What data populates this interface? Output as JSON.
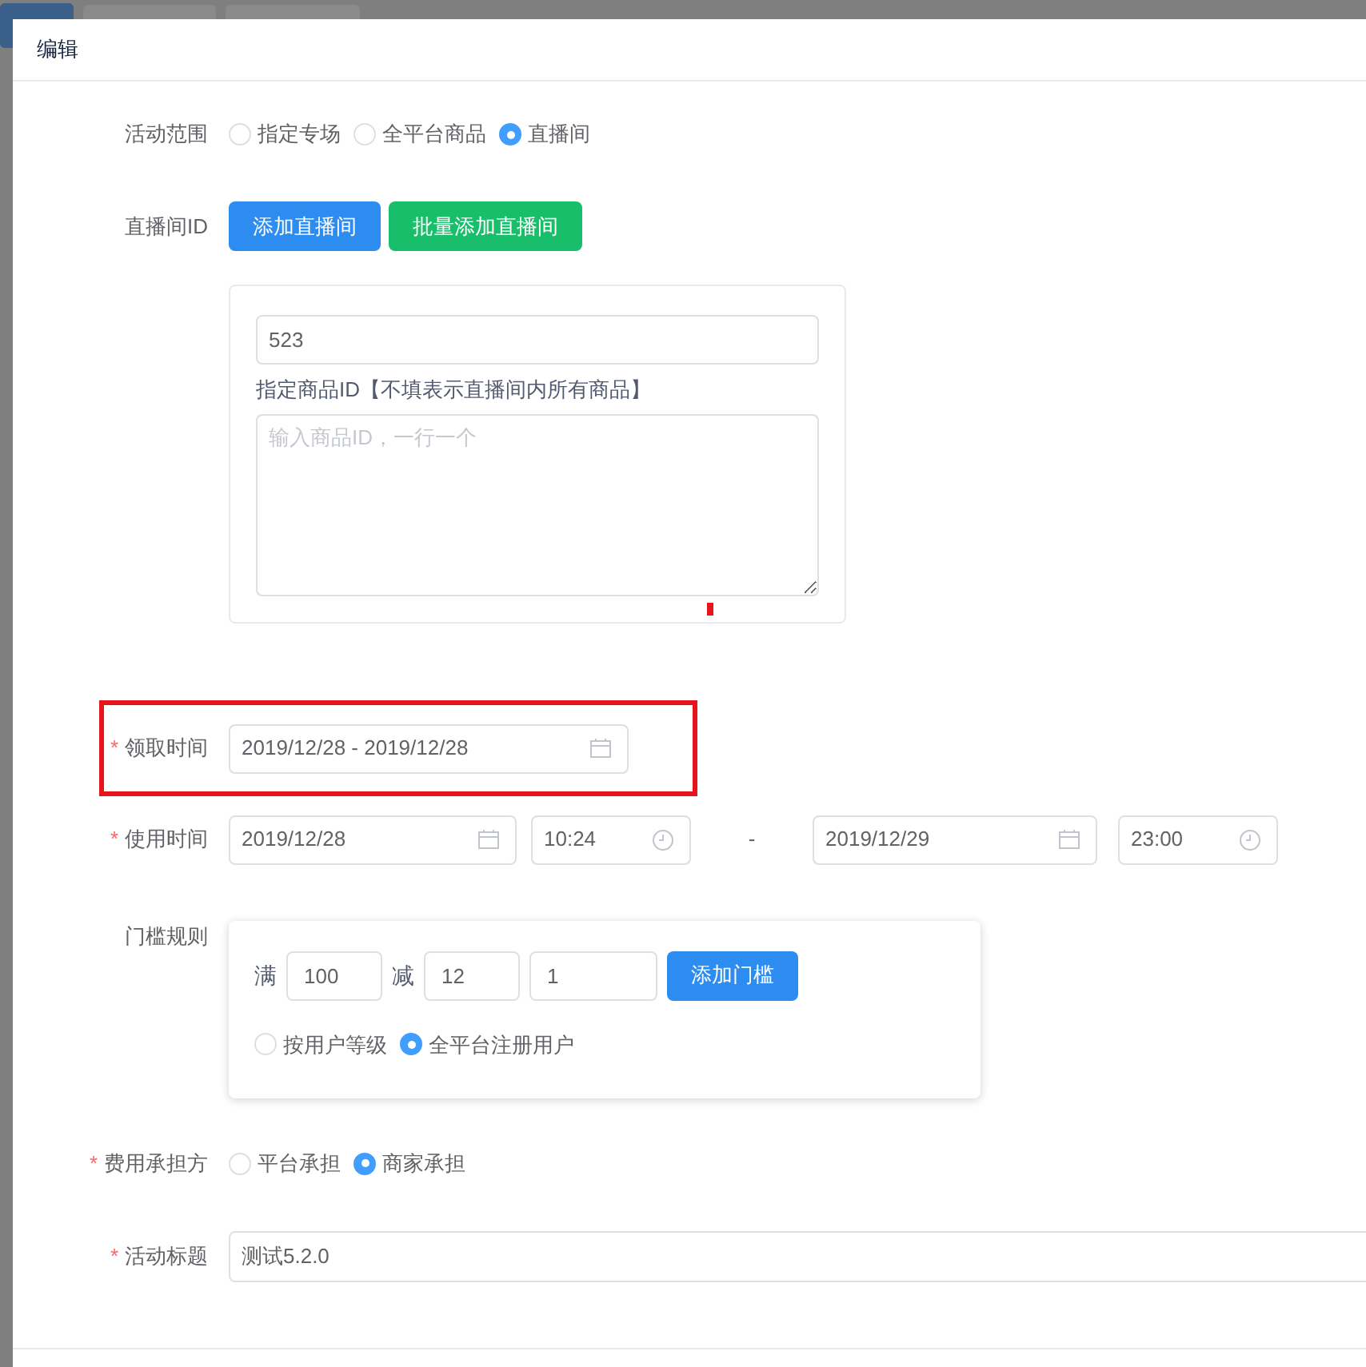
{
  "dialog": {
    "title": "编辑"
  },
  "form": {
    "scope": {
      "label": "活动范围",
      "options": [
        {
          "label": "指定专场",
          "selected": false
        },
        {
          "label": "全平台商品",
          "selected": false
        },
        {
          "label": "直播间",
          "selected": true
        }
      ]
    },
    "live_room": {
      "label": "直播间ID",
      "buttons": [
        {
          "label": "添加直播间",
          "kind": "primary"
        },
        {
          "label": "批量添加直播间",
          "kind": "success"
        }
      ],
      "room_id": {
        "value": "523"
      },
      "product_ids": {
        "label": "指定商品ID【不填表示直播间内所有商品】",
        "placeholder": "输入商品ID，一行一个"
      }
    },
    "claim_time": {
      "required_mark": "*",
      "label": "领取时间",
      "highlighted": true,
      "value": "2019/12/28 - 2019/12/28"
    },
    "use_time": {
      "required_mark": "*",
      "label": "使用时间",
      "start_date": "2019/12/28",
      "start_time": "10:24",
      "separator": "-",
      "end_date": "2019/12/29",
      "end_time": "23:00"
    },
    "threshold": {
      "label": "门槛规则",
      "full_label": "满",
      "full_value": "100",
      "minus_label": "减",
      "minus_value": "12",
      "count_value": "1",
      "button": "添加门槛",
      "user_options": [
        {
          "label": "按用户等级",
          "selected": false
        },
        {
          "label": "全平台注册用户",
          "selected": true
        }
      ]
    },
    "cost": {
      "required_mark": "*",
      "label": "费用承担方",
      "options": [
        {
          "label": "平台承担",
          "selected": false
        },
        {
          "label": "商家承担",
          "selected": true
        }
      ]
    },
    "title": {
      "required_mark": "*",
      "label": "活动标题",
      "value": "测试5.2.0"
    }
  }
}
